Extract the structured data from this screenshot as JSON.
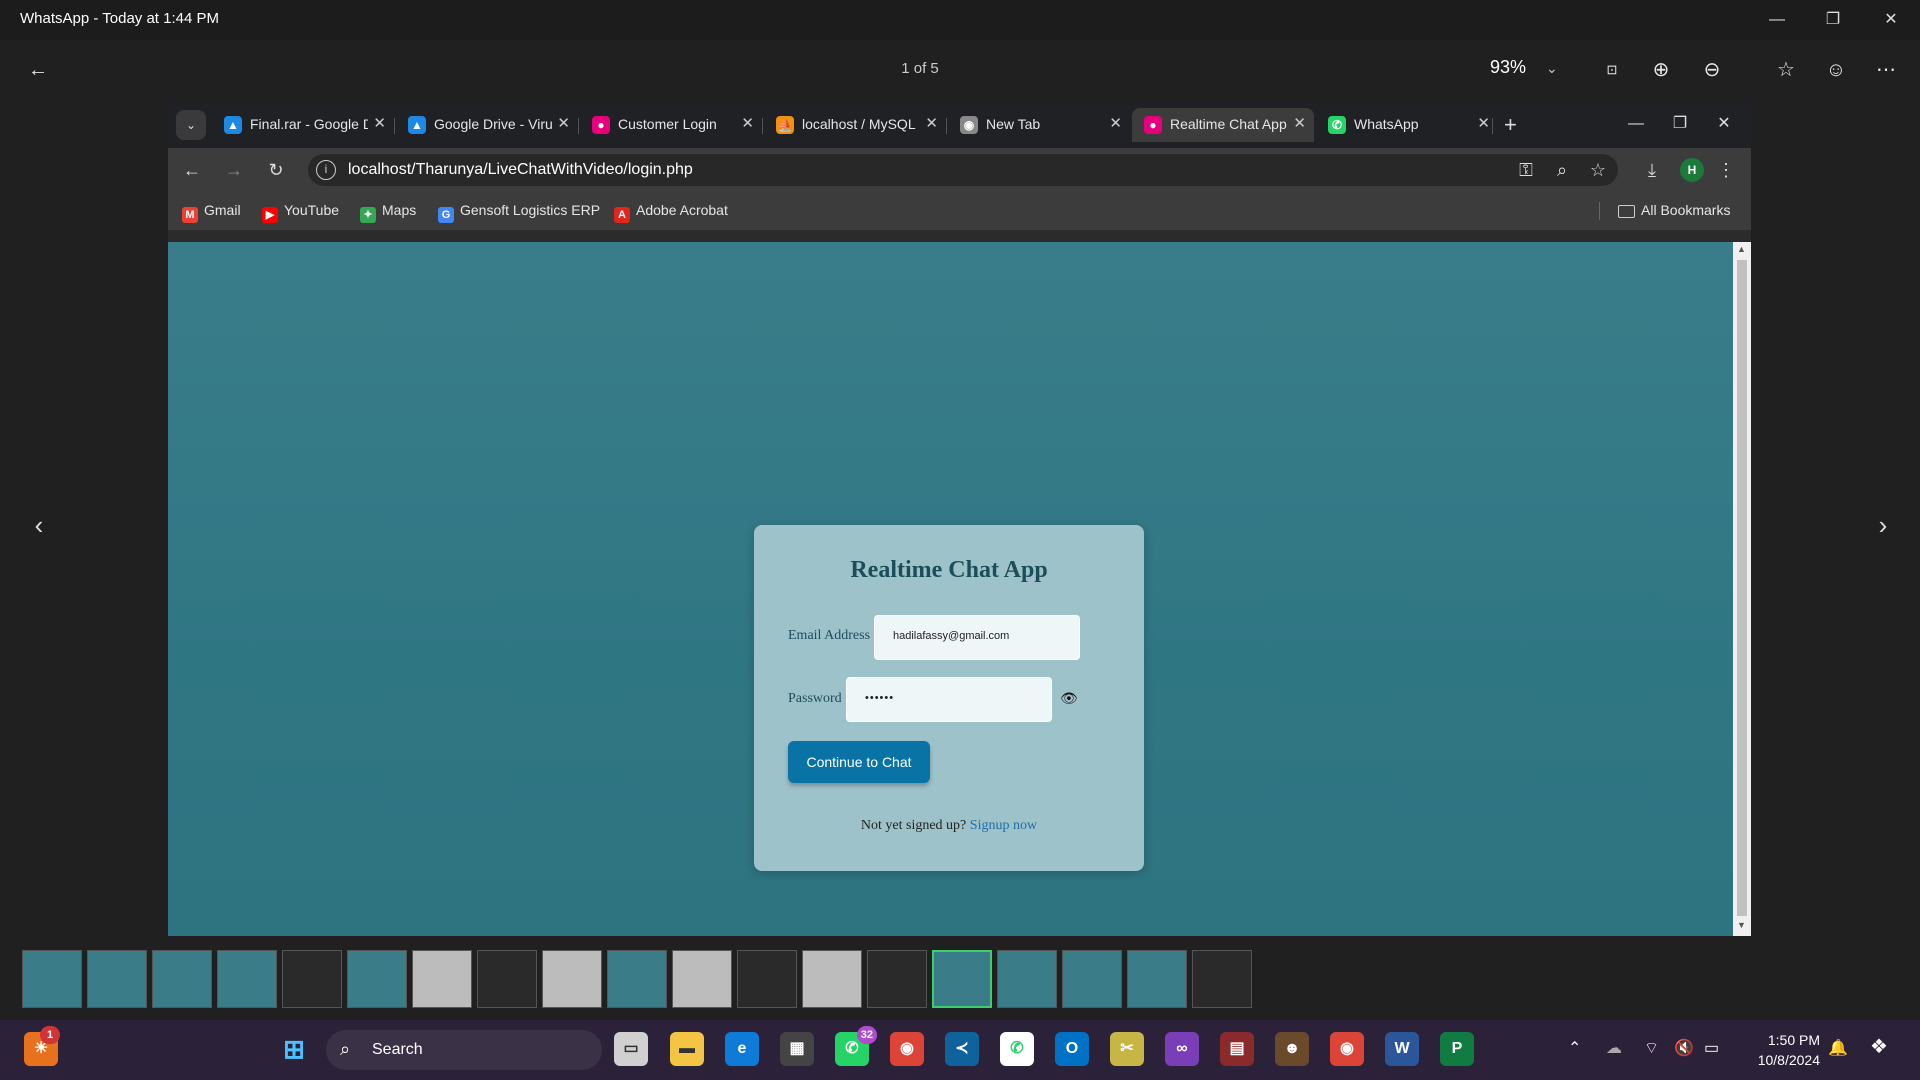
{
  "viewer": {
    "title": "WhatsApp - Today at 1:44 PM",
    "counter": "1 of 5",
    "zoom": "93%"
  },
  "browser": {
    "tabs": [
      {
        "label": "Final.rar - Google Drive",
        "icon": "drive-icon",
        "color": "#1e88e5"
      },
      {
        "label": "Google Drive - Virus scan",
        "icon": "drive-icon",
        "color": "#1e88e5"
      },
      {
        "label": "Customer Login",
        "icon": "app-icon",
        "color": "#e6007e"
      },
      {
        "label": "localhost / MySQL",
        "icon": "phpmyadmin-icon",
        "color": "#f29111"
      },
      {
        "label": "New Tab",
        "icon": "chrome-icon",
        "color": "#888888"
      },
      {
        "label": "Realtime Chat App",
        "icon": "app-icon",
        "color": "#e6007e"
      },
      {
        "label": "WhatsApp",
        "icon": "whatsapp-icon",
        "color": "#25d366"
      }
    ],
    "url": "localhost/Tharunya/LiveChatWithVideo/login.php",
    "profile_initial": "H",
    "bookmarks": [
      {
        "label": "Gmail",
        "icon": "gmail-icon",
        "color": "#ea4335"
      },
      {
        "label": "YouTube",
        "icon": "youtube-icon",
        "color": "#ff0000"
      },
      {
        "label": "Maps",
        "icon": "maps-icon",
        "color": "#34a853"
      },
      {
        "label": "Gensoft Logistics ERP",
        "icon": "gensoft-icon",
        "color": "#4285f4"
      },
      {
        "label": "Adobe Acrobat",
        "icon": "acrobat-icon",
        "color": "#e1251b"
      }
    ],
    "all_bookmarks": "All Bookmarks"
  },
  "login": {
    "title": "Realtime Chat App",
    "email_label": "Email Address",
    "email_value": "hadilafassy@gmail.com",
    "password_label": "Password",
    "password_value": "••••••",
    "button": "Continue to Chat",
    "signup_text": "Not yet signed up?",
    "signup_link": "Signup now"
  },
  "taskbar": {
    "search": "Search",
    "whatsapp_badge": "32",
    "notif_badge": "1",
    "time": "1:50 PM",
    "date": "10/8/2024"
  }
}
